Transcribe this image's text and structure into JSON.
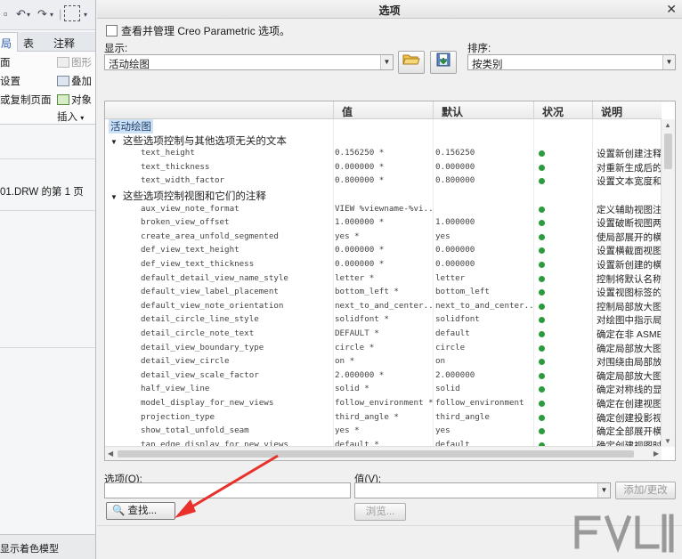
{
  "left_panel": {
    "ribbon_tabs": [
      "局",
      "表",
      "注释"
    ],
    "ribbon_items": {
      "page": "面",
      "graph": "图形",
      "settings": "设置",
      "overlay": "叠加",
      "copy_page": "或复制页面",
      "object": "对象",
      "insert": "插入"
    },
    "page_info": "01.DRW 的第 1 页",
    "status": "显示着色模型"
  },
  "dialog": {
    "title": "选项",
    "checkbox_label": "查看并管理 Creo Parametric 选项。",
    "show_label": "显示:",
    "show_value": "活动绘图",
    "sort_label": "排序:",
    "sort_value": "按类别",
    "columns": [
      "值",
      "默认",
      "状况",
      "说明"
    ],
    "root_label": "活动绘图",
    "groups": [
      {
        "label": "这些选项控制与其他选项无关的文本",
        "options": [
          {
            "name": "text_height",
            "value": "0.156250 *",
            "default": "0.156250",
            "desc": "设置新创建注释"
          },
          {
            "name": "text_thickness",
            "value": "0.000000 *",
            "default": "0.000000",
            "desc": "对重新生成后的"
          },
          {
            "name": "text_width_factor",
            "value": "0.800000 *",
            "default": "0.800000",
            "desc": "设置文本宽度和"
          }
        ]
      },
      {
        "label": "这些选项控制视图和它们的注释",
        "options": [
          {
            "name": "aux_view_note_format",
            "value": "VIEW %viewname-%vi...",
            "default": "",
            "desc": "定义辅助视图注"
          },
          {
            "name": "broken_view_offset",
            "value": "1.000000 *",
            "default": "1.000000",
            "desc": "设置破断视图两"
          },
          {
            "name": "create_area_unfold_segmented",
            "value": "yes *",
            "default": "yes",
            "desc": "使局部展开的横"
          },
          {
            "name": "def_view_text_height",
            "value": "0.000000 *",
            "default": "0.000000",
            "desc": "设置横截面视图"
          },
          {
            "name": "def_view_text_thickness",
            "value": "0.000000 *",
            "default": "0.000000",
            "desc": "设置新创建的横"
          },
          {
            "name": "default_detail_view_name_style",
            "value": "letter *",
            "default": "letter",
            "desc": "控制将默认名称"
          },
          {
            "name": "default_view_label_placement",
            "value": "bottom_left *",
            "default": "bottom_left",
            "desc": "设置视图标签的"
          },
          {
            "name": "default_view_note_orientation",
            "value": "next_to_and_center...",
            "default": "next_to_and_center...",
            "desc": "控制局部放大图"
          },
          {
            "name": "detail_circle_line_style",
            "value": "solidfont *",
            "default": "solidfont",
            "desc": "对绘图中指示局"
          },
          {
            "name": "detail_circle_note_text",
            "value": "DEFAULT *",
            "default": "default",
            "desc": "确定在非 ASME一"
          },
          {
            "name": "detail_view_boundary_type",
            "value": "circle *",
            "default": "circle",
            "desc": "确定局部放大图"
          },
          {
            "name": "detail_view_circle",
            "value": "on *",
            "default": "on",
            "desc": "对围绕由局部放"
          },
          {
            "name": "detail_view_scale_factor",
            "value": "2.000000 *",
            "default": "2.000000",
            "desc": "确定局部放大图"
          },
          {
            "name": "half_view_line",
            "value": "solid *",
            "default": "solid",
            "desc": "确定对称线的显"
          },
          {
            "name": "model_display_for_new_views",
            "value": "follow_environment *",
            "default": "follow_environment",
            "desc": "确定在创建视图"
          },
          {
            "name": "projection_type",
            "value": "third_angle *",
            "default": "third_angle",
            "desc": "确定创建投影视"
          },
          {
            "name": "show_total_unfold_seam",
            "value": "yes *",
            "default": "yes",
            "desc": "确定全部展开横"
          },
          {
            "name": "tan_edge_display_for_new_views",
            "value": "default *",
            "default": "default",
            "desc": "确定创建视图时"
          }
        ]
      }
    ],
    "option_label": "选项(O):",
    "value_label": "值(V):",
    "add_change": "添加/更改",
    "find_button": "查找...",
    "browse_button": "浏览...",
    "status_color": "#2c9b3c",
    "arrow_color": "#e8312b"
  }
}
